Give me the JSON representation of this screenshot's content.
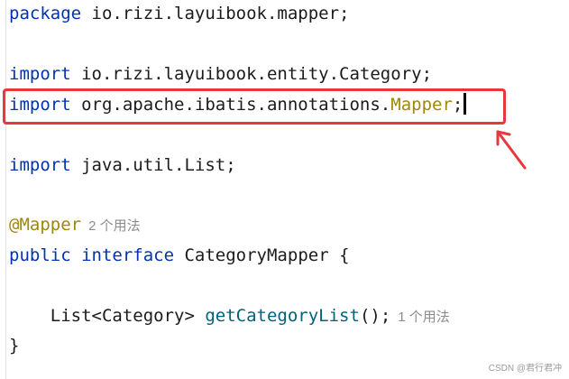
{
  "colors": {
    "keyword": "#0033b3",
    "annotation": "#9e880d",
    "method": "#00627a",
    "text": "#1b1b1b",
    "hint": "#8c8c8c",
    "highlight_border": "#e8383d"
  },
  "code": {
    "line1": {
      "keyword": "package",
      "rest": " io.rizi.layuibook.mapper;"
    },
    "line3": {
      "keyword": "import",
      "rest": " io.rizi.layuibook.entity.Category;"
    },
    "line4": {
      "keyword": "import",
      "rest_plain": " org.apache.ibatis.annotations.",
      "rest_highlight": "Mapper",
      "rest_end": ";"
    },
    "line6": {
      "keyword": "import",
      "rest": " java.util.List;"
    },
    "line8": {
      "annotation": "@Mapper",
      "hint": "2 个用法"
    },
    "line9": {
      "keyword1": "public",
      "keyword2": "interface",
      "rest": " CategoryMapper {"
    },
    "line11": {
      "prefix": "    List<Category> ",
      "method": "getCategoryList",
      "suffix": "();",
      "hint": "1 个用法"
    },
    "line12": {
      "text": "}"
    }
  },
  "watermark": "CSDN @君行君冲"
}
